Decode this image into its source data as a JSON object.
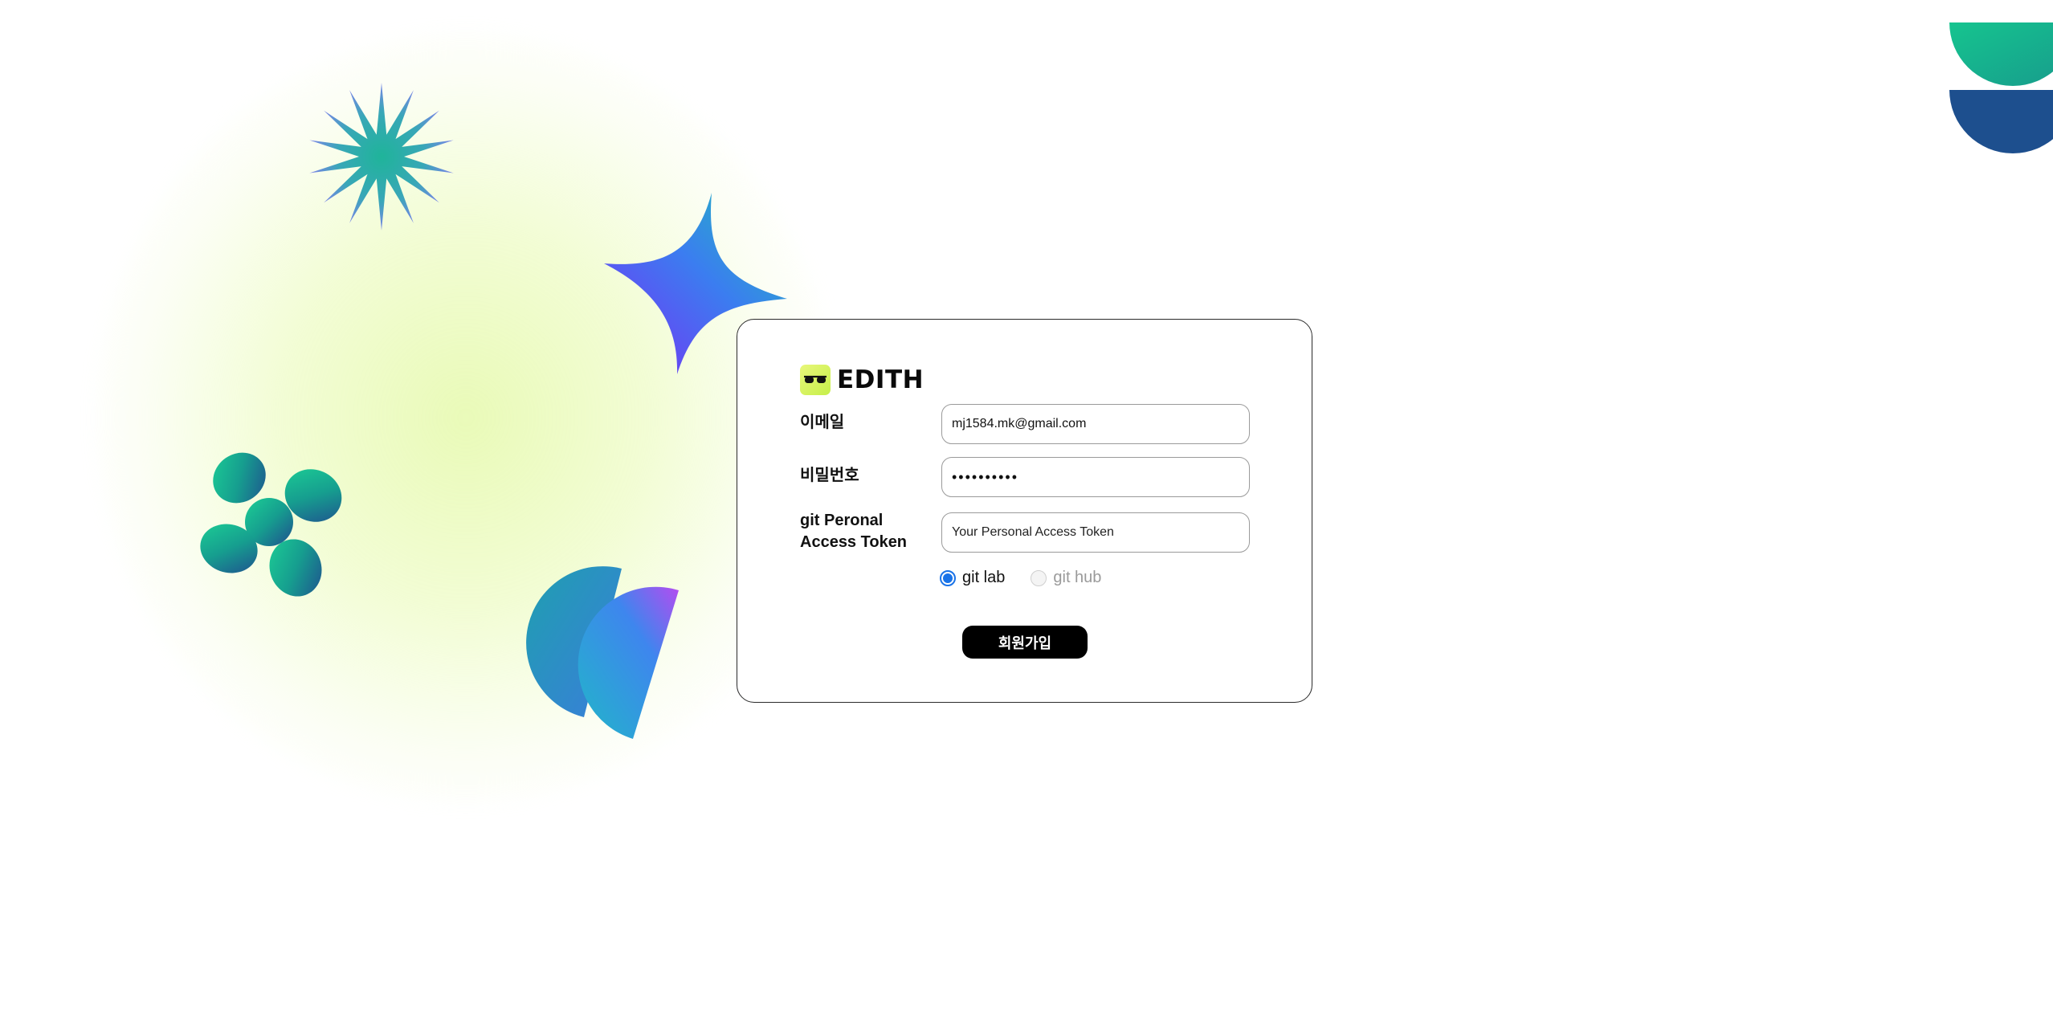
{
  "brand": {
    "name": "EDITH",
    "logo_icon": "glasses-icon",
    "logo_color": "#d4f25c"
  },
  "form": {
    "email": {
      "label": "이메일",
      "value": "mj1584.mk@gmail.com"
    },
    "password": {
      "label": "비밀번호",
      "value": "••••••••••"
    },
    "token": {
      "label_line1": "git Peronal",
      "label_line2": "Access Token",
      "placeholder": "Your Personal Access Token"
    },
    "provider": {
      "options": [
        {
          "label": "git lab",
          "selected": true
        },
        {
          "label": "git hub",
          "selected": false
        }
      ]
    },
    "submit_label": "회원가입"
  },
  "colors": {
    "accent": "#1a73e8",
    "button_bg": "#000000",
    "glow": "#eef9c2"
  },
  "decorations": [
    "starburst-shape",
    "four-point-star-shape",
    "flower-shape",
    "split-circle-shape",
    "half-circles-shape"
  ]
}
